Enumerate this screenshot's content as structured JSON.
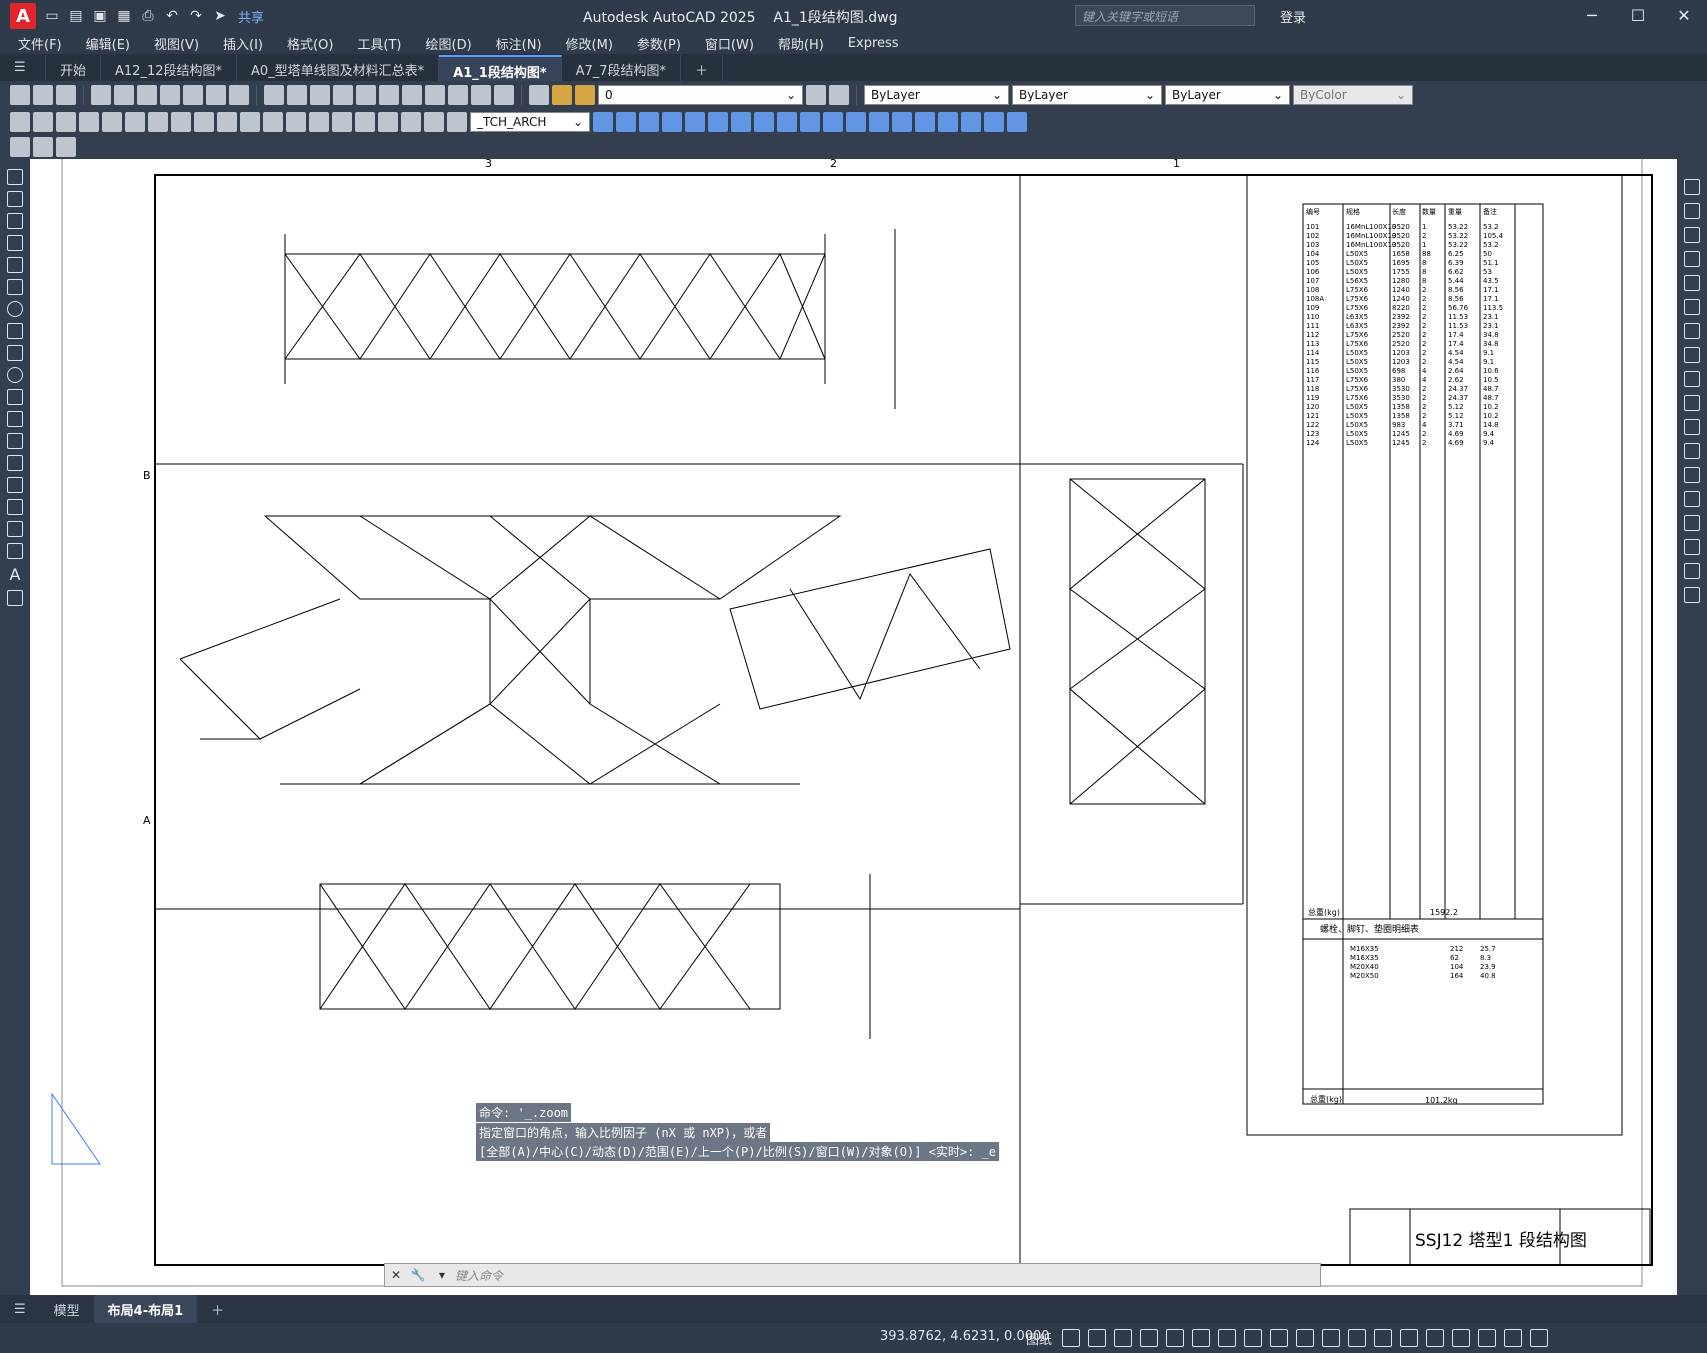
{
  "app": {
    "title": "Autodesk AutoCAD 2025",
    "file": "A1_1段结构图.dwg",
    "logo": "A",
    "share": "共享",
    "search_placeholder": "键入关键字或短语",
    "login": "登录"
  },
  "menu": [
    "文件(F)",
    "编辑(E)",
    "视图(V)",
    "插入(I)",
    "格式(O)",
    "工具(T)",
    "绘图(D)",
    "标注(N)",
    "修改(M)",
    "参数(P)",
    "窗口(W)",
    "帮助(H)",
    "Express"
  ],
  "tabs": [
    {
      "label": "开始"
    },
    {
      "label": "A12_12段结构图*"
    },
    {
      "label": "A0_型塔单线图及材料汇总表*"
    },
    {
      "label": "A1_1段结构图*",
      "active": true
    },
    {
      "label": "A7_7段结构图*"
    }
  ],
  "toolbar": {
    "layer": "0",
    "color": "ByLayer",
    "linetype": "ByLayer",
    "lineweight": "ByLayer",
    "plotstyle": "ByColor",
    "textstyle": "_TCH_ARCH"
  },
  "drawing": {
    "grid_numbers": [
      "3",
      "2",
      "1"
    ],
    "grid_letters": [
      "B",
      "A"
    ],
    "title_block": "SSJ12 塔型1 段结构图",
    "table_headers": [
      "编号",
      "规格",
      "长度",
      "数量",
      "重量",
      "备注"
    ],
    "total_weight_label": "总重(kg)",
    "total_weight": "1592.2",
    "bolt_table_title": "螺栓、脚钉、垫圈明细表",
    "bolt_total": "101.2kg",
    "bolts": [
      {
        "spec": "M16X35",
        "count": "212",
        "weight": "25.7"
      },
      {
        "spec": "M16X35",
        "count": "62",
        "weight": "8.3"
      },
      {
        "spec": "M20X40",
        "count": "104",
        "weight": "23.9"
      },
      {
        "spec": "M20X50",
        "count": "164",
        "weight": "40.8"
      }
    ],
    "parts": [
      [
        "101",
        "16MnL100X10",
        "3520",
        "1",
        "53.22",
        "53.2"
      ],
      [
        "102",
        "16MnL100X10",
        "3520",
        "2",
        "53.22",
        "105.4"
      ],
      [
        "103",
        "16MnL100X10",
        "3520",
        "1",
        "53.22",
        "53.2"
      ],
      [
        "104",
        "L50X5",
        "1658",
        "88",
        "6.25",
        "50"
      ],
      [
        "105",
        "L50X5",
        "1695",
        "8",
        "6.39",
        "51.1"
      ],
      [
        "106",
        "L50X5",
        "1755",
        "8",
        "6.62",
        "53"
      ],
      [
        "107",
        "L56X5",
        "1280",
        "8",
        "5.44",
        "43.5"
      ],
      [
        "108",
        "L75X6",
        "1240",
        "2",
        "8.56",
        "17.1"
      ],
      [
        "108A",
        "L75X6",
        "1240",
        "2",
        "8.56",
        "17.1"
      ],
      [
        "109",
        "L75X6",
        "8220",
        "2",
        "56.76",
        "113.5"
      ],
      [
        "110",
        "L63X5",
        "2392",
        "2",
        "11.53",
        "23.1"
      ],
      [
        "111",
        "L63X5",
        "2392",
        "2",
        "11.53",
        "23.1"
      ],
      [
        "112",
        "L75X6",
        "2520",
        "2",
        "17.4",
        "34.8"
      ],
      [
        "113",
        "L75X6",
        "2520",
        "2",
        "17.4",
        "34.8"
      ],
      [
        "114",
        "L50X5",
        "1203",
        "2",
        "4.54",
        "9.1"
      ],
      [
        "115",
        "L50X5",
        "1203",
        "2",
        "4.54",
        "9.1"
      ],
      [
        "116",
        "L50X5",
        "698",
        "4",
        "2.64",
        "10.6"
      ],
      [
        "117",
        "L75X6",
        "380",
        "4",
        "2.62",
        "10.5"
      ],
      [
        "118",
        "L75X6",
        "3530",
        "2",
        "24.37",
        "48.7"
      ],
      [
        "119",
        "L75X6",
        "3530",
        "2",
        "24.37",
        "48.7"
      ],
      [
        "120",
        "L50X5",
        "1358",
        "2",
        "5.12",
        "10.2"
      ],
      [
        "121",
        "L50X5",
        "1358",
        "2",
        "5.12",
        "10.2"
      ],
      [
        "122",
        "L50X5",
        "983",
        "4",
        "3.71",
        "14.8"
      ],
      [
        "123",
        "L50X5",
        "1245",
        "2",
        "4.69",
        "9.4"
      ],
      [
        "124",
        "L50X5",
        "1245",
        "2",
        "4.69",
        "9.4"
      ]
    ],
    "command_history": [
      "命令: '_.zoom",
      "指定窗口的角点，输入比例因子 (nX 或 nXP)，或者",
      "[全部(A)/中心(C)/动态(D)/范围(E)/上一个(P)/比例(S)/窗口(W)/对象(O)] <实时>: _e"
    ],
    "command_placeholder": "键入命令"
  },
  "layout_tabs": [
    "模型",
    "布局4-布局1"
  ],
  "status": {
    "coords": "393.8762, 4.6231, 0.0000",
    "space": "图纸"
  }
}
